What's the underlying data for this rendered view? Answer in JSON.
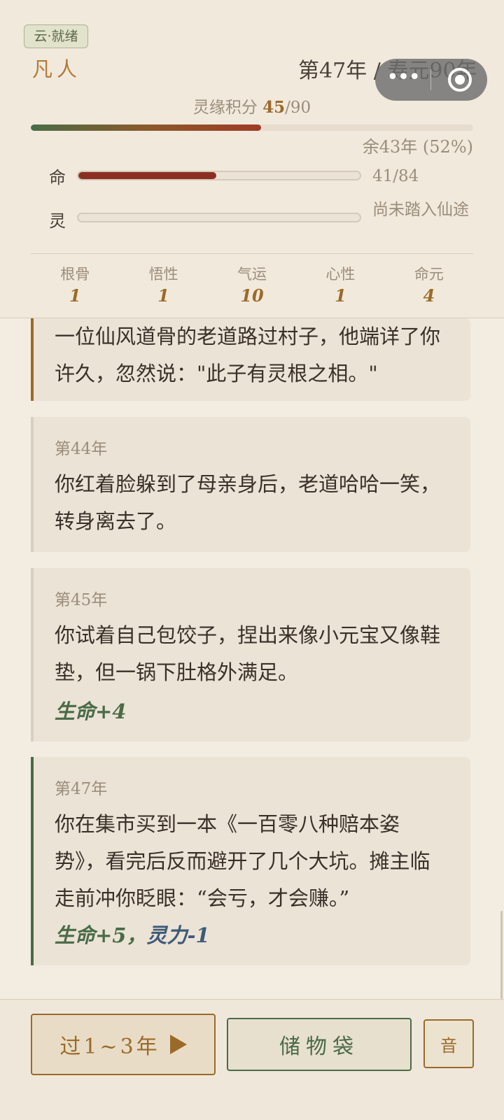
{
  "header": {
    "cloud_status": "云·就绪",
    "realm": "凡人",
    "year_info": "第47年 / 寿元90年",
    "score_label": "灵缘积分",
    "score_current": "45",
    "score_total": "/90",
    "lifespan_progress_fraction": 0.52,
    "remaining": "余43年 (52%)",
    "stats": [
      {
        "label": "命",
        "value": "41/84",
        "fill_fraction": 0.49
      },
      {
        "label": "灵",
        "value": "尚未踏入仙途",
        "fill_fraction": 0
      }
    ],
    "attributes": [
      {
        "name": "根骨",
        "value": "1"
      },
      {
        "name": "悟性",
        "value": "1"
      },
      {
        "name": "气运",
        "value": "10"
      },
      {
        "name": "心性",
        "value": "1"
      },
      {
        "name": "命元",
        "value": "4"
      }
    ]
  },
  "events": [
    {
      "year": "",
      "text": "一位仙风道骨的老道路过村子，他端详了你许久，忽然说：\"此子有灵根之相。\"",
      "effect": "",
      "accent": "#9b6a2a"
    },
    {
      "year": "第44年",
      "text": "你红着脸躲到了母亲身后，老道哈哈一笑，转身离去了。",
      "effect": "",
      "accent": "#d8cfc1"
    },
    {
      "year": "第45年",
      "text": "你试着自己包饺子，捏出来像小元宝又像鞋垫，但一锅下肚格外满足。",
      "effect": "生命+4",
      "accent": "#d8cfc1"
    },
    {
      "year": "第47年",
      "text": "你在集市买到一本《一百零八种赔本姿势》，看完后反而避开了几个大坑。摊主临走前冲你眨眼：“会亏，才会赚。”",
      "effect_life": "生命+5，",
      "effect_spirit": "灵力-1",
      "accent": "#4a6b48"
    }
  ],
  "footer": {
    "pass_label": "过1~3年",
    "bag_label": "储物袋",
    "sound_label": "音"
  },
  "icons": {
    "more": "more-dots-icon",
    "close": "miniapp-close-icon",
    "play": "play-arrow-icon"
  }
}
